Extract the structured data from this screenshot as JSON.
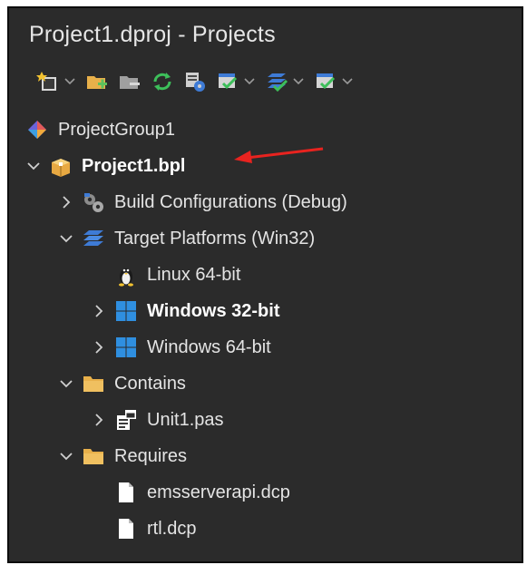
{
  "window": {
    "title": "Project1.dproj - Projects"
  },
  "toolbar": {
    "buttons": [
      {
        "icon": "new-icon",
        "dropdown": true
      },
      {
        "icon": "add-folder-icon",
        "dropdown": false
      },
      {
        "icon": "remove-folder-icon",
        "dropdown": false
      },
      {
        "icon": "sync-icon",
        "dropdown": false
      },
      {
        "icon": "options-icon",
        "dropdown": false
      },
      {
        "icon": "build-config-icon",
        "dropdown": true
      },
      {
        "icon": "build-all-icon",
        "dropdown": true
      },
      {
        "icon": "deploy-icon",
        "dropdown": true
      }
    ]
  },
  "tree": {
    "group": {
      "label": "ProjectGroup1",
      "icon": "project-group-icon"
    },
    "project": {
      "label": "Project1.bpl",
      "icon": "package-icon",
      "expanded": true
    },
    "build_configurations": {
      "label": "Build Configurations (Debug)",
      "icon": "gears-icon",
      "expanded": false
    },
    "target_platforms": {
      "label": "Target Platforms (Win32)",
      "icon": "platforms-icon",
      "expanded": true
    },
    "platforms": [
      {
        "label": "Linux 64-bit",
        "icon": "linux-icon",
        "active": false,
        "expandable": false
      },
      {
        "label": "Windows 32-bit",
        "icon": "windows-icon",
        "active": true,
        "expandable": true
      },
      {
        "label": "Windows 64-bit",
        "icon": "windows-icon",
        "active": false,
        "expandable": true
      }
    ],
    "contains": {
      "label": "Contains",
      "icon": "folder-icon",
      "expanded": true
    },
    "contains_files": [
      {
        "label": "Unit1.pas",
        "icon": "pas-file-icon"
      }
    ],
    "requires": {
      "label": "Requires",
      "icon": "folder-icon",
      "expanded": true
    },
    "requires_files": [
      {
        "label": "emsserverapi.dcp",
        "icon": "file-icon"
      },
      {
        "label": "rtl.dcp",
        "icon": "file-icon"
      }
    ]
  },
  "annotation": {
    "arrow_color": "#e8231f"
  },
  "colors": {
    "background": "#2b2b2b",
    "text": "#e4e4e4",
    "folder": "#e8b04a",
    "windows": "#2f8fe0"
  }
}
